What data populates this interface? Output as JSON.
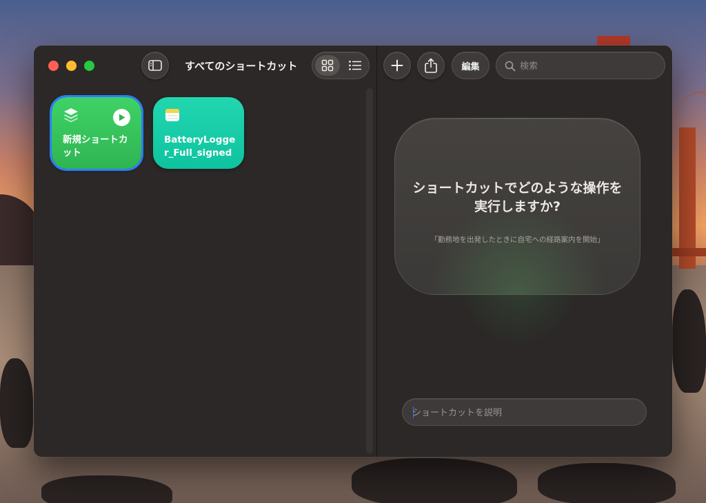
{
  "window": {
    "title": "すべてのショートカット"
  },
  "toolbar": {
    "sidebar_toggle_icon": "sidebar-icon",
    "view_grid_icon": "grid-icon",
    "view_list_icon": "list-icon",
    "add_icon": "plus-icon",
    "share_icon": "share-icon",
    "edit_label": "編集",
    "search_placeholder": "検索"
  },
  "shortcuts": [
    {
      "label": "新規ショートカット",
      "icon": "layers-icon",
      "color": "#34c759",
      "selected": true,
      "has_play": true
    },
    {
      "label": "BatteryLogger_Full_signed",
      "icon": "notes-icon",
      "color": "#1ccfa8",
      "selected": false,
      "has_play": false
    }
  ],
  "assistant": {
    "prompt_title": "ショートカットでどのような操作を実行しますか?",
    "prompt_example": "「勤務地を出発したときに自宅への経路案内を開始」",
    "describe_placeholder": "ショートカットを説明"
  },
  "colors": {
    "accent": "#2a7fff",
    "close": "#fe5f57",
    "minimize": "#febc2e",
    "maximize": "#28c840"
  }
}
